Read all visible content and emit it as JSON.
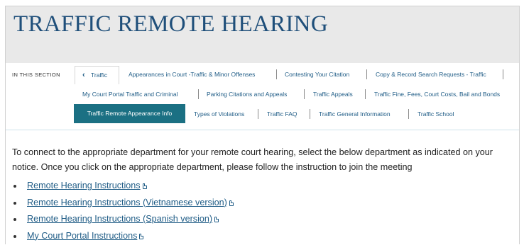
{
  "header": {
    "title": "TRAFFIC REMOTE HEARING"
  },
  "nav": {
    "section_label": "IN THIS SECTION",
    "back": {
      "label": "Traffic"
    },
    "row1": [
      "Appearances in Court -Traffic & Minor Offenses",
      "Contesting Your Citation",
      "Copy & Record Search Requests - Traffic"
    ],
    "row2": [
      "My Court Portal Traffic and Criminal",
      "Parking Citations and Appeals",
      "Traffic Appeals",
      "Traffic Fine, Fees, Court Costs, Bail and Bonds"
    ],
    "row3_active": "Traffic Remote Appearance Info",
    "row3": [
      "Types of Violations",
      "Traffic FAQ",
      "Traffic General Information",
      "Traffic School"
    ]
  },
  "content": {
    "intro": "To connect to the appropriate department for your remote court hearing, select the below department as indicated on your notice. Once you click on the appropriate department, please follow the instruction to join the meeting",
    "links": [
      "Remote Hearing Instructions",
      "Remote Hearing Instructions (Vietnamese version)",
      "Remote Hearing Instructions (Spanish version)",
      "My Court Portal Instructions"
    ]
  },
  "icons": {
    "back": "chevron-left-icon",
    "document": "document-icon"
  },
  "colors": {
    "accent": "#1b7083",
    "link": "#1f5c86",
    "title": "#1f4f7a",
    "header_bg": "#e9e9e9"
  }
}
